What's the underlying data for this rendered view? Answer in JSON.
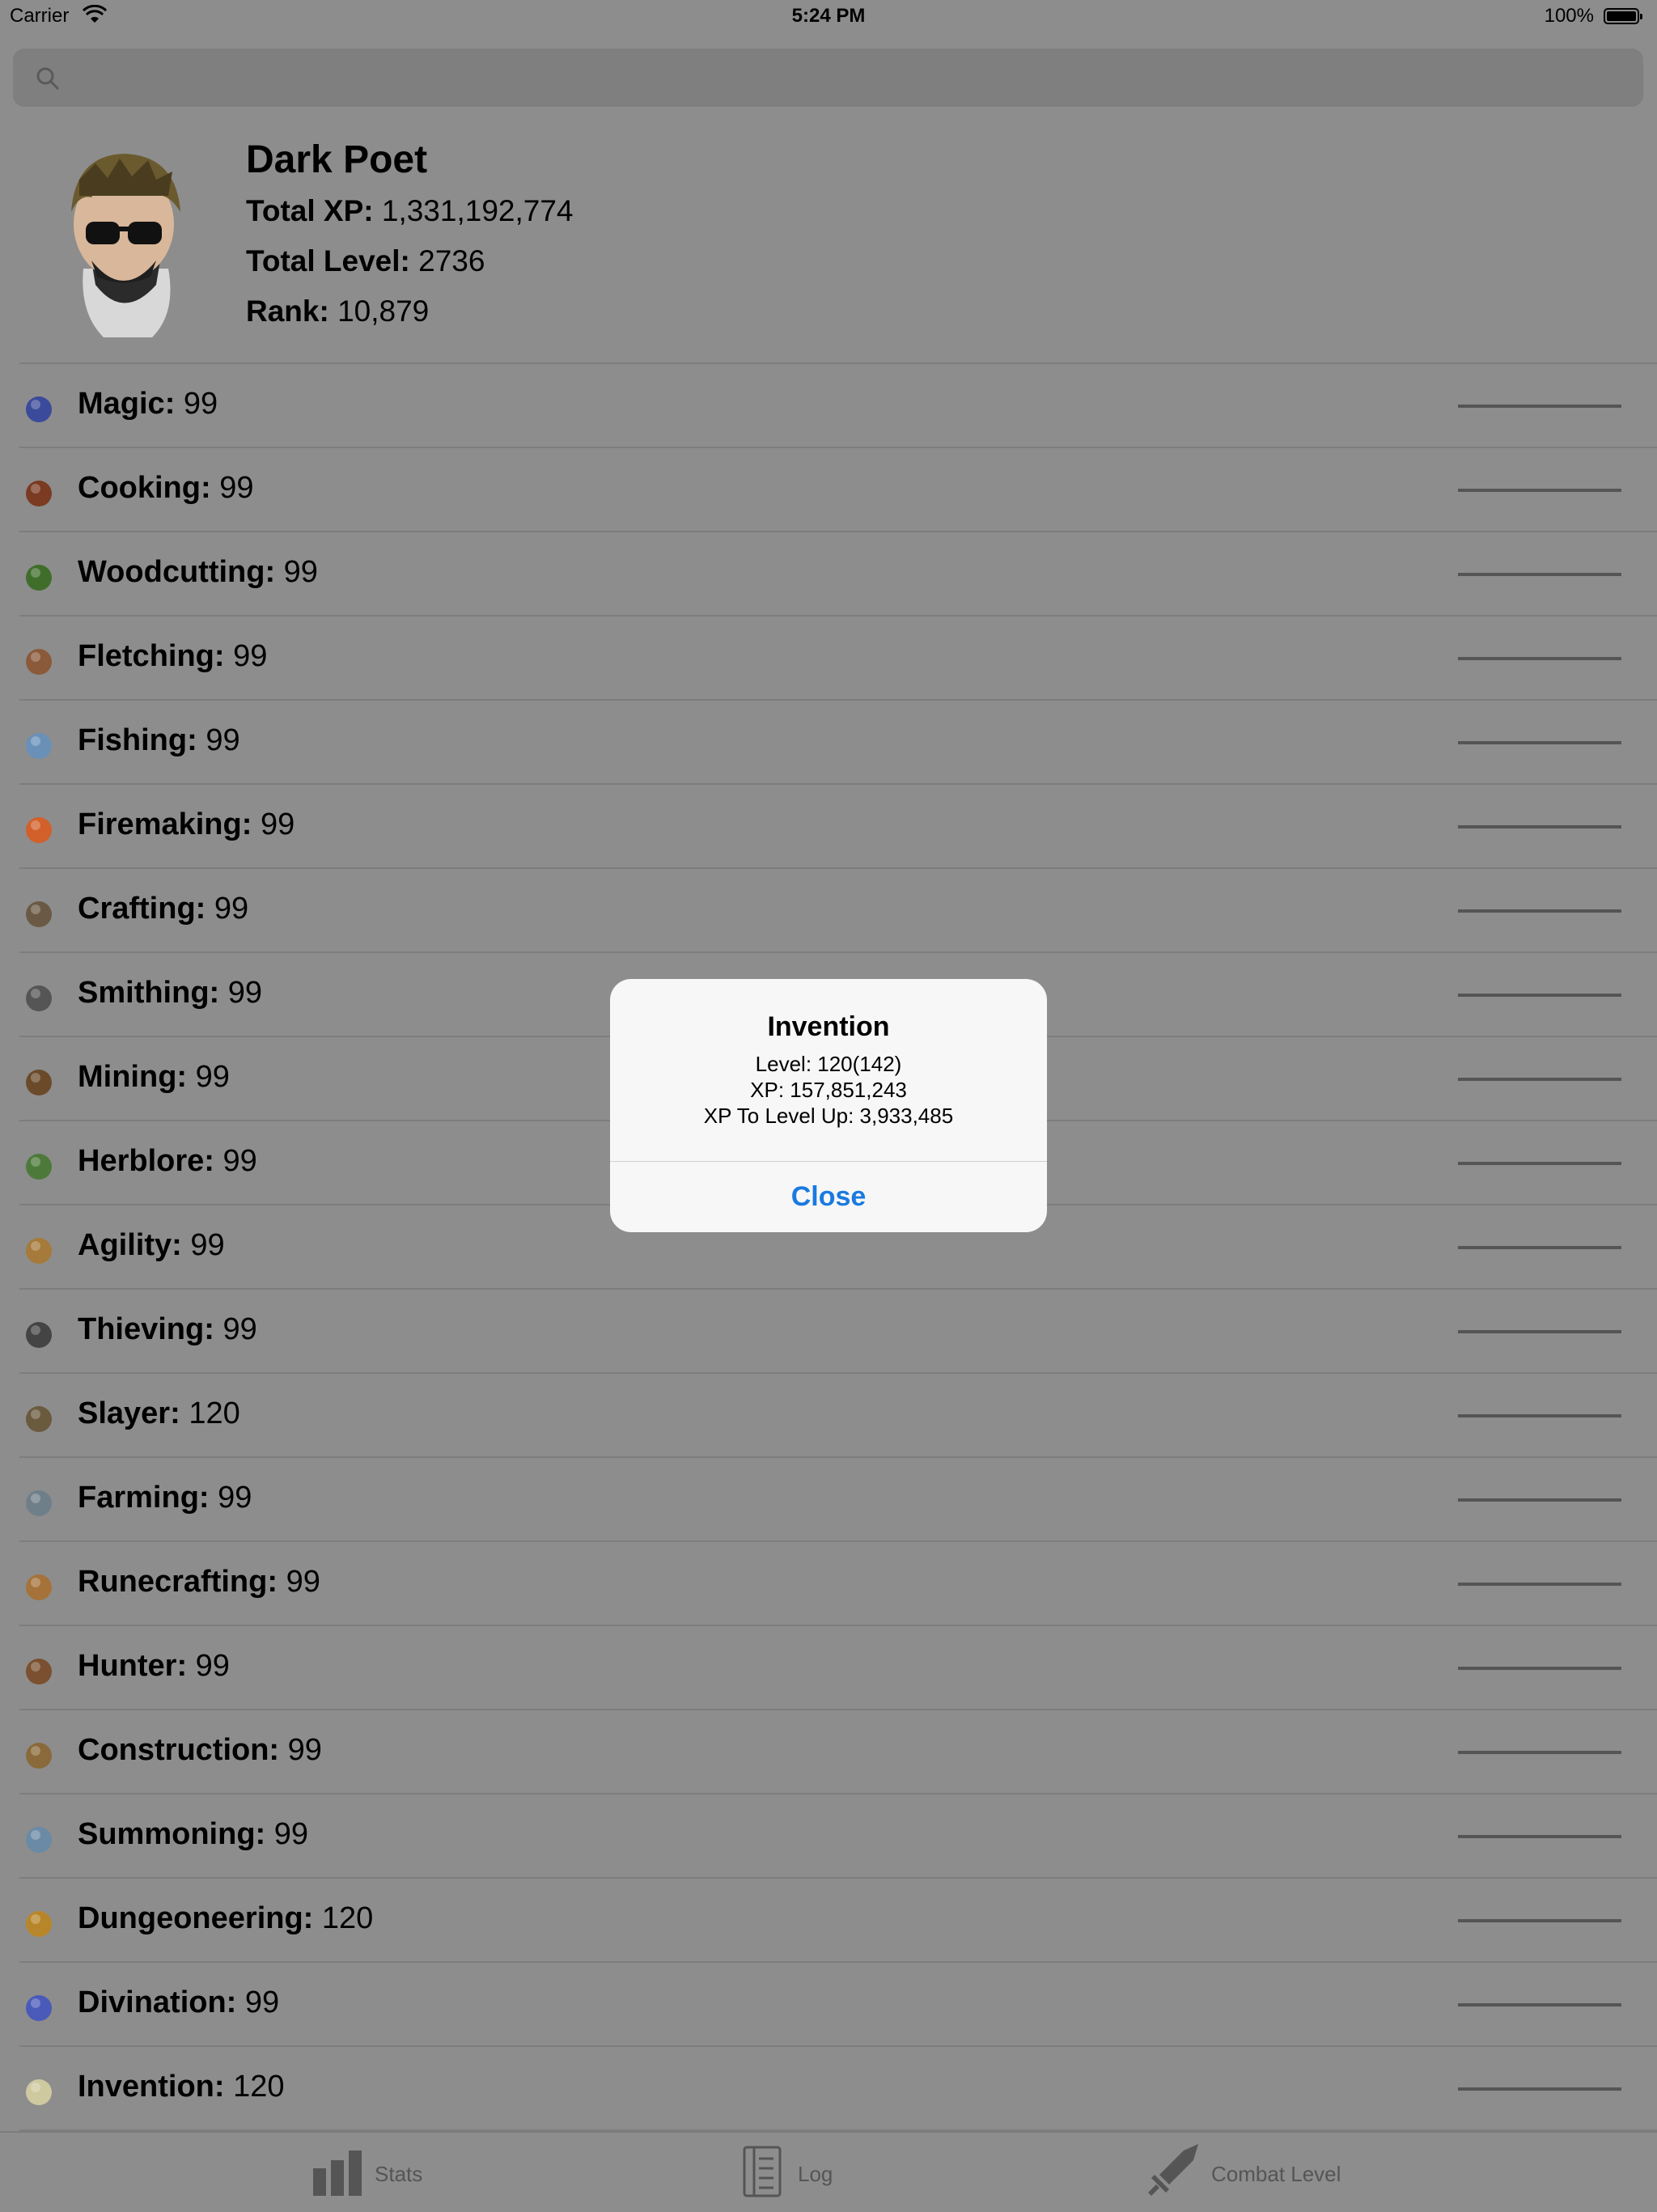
{
  "status_bar": {
    "carrier": "Carrier",
    "time": "5:24 PM",
    "battery": "100%"
  },
  "search": {
    "placeholder": ""
  },
  "profile": {
    "name": "Dark Poet",
    "total_xp_label": "Total XP:",
    "total_xp": "1,331,192,774",
    "total_level_label": "Total Level:",
    "total_level": "2736",
    "rank_label": "Rank:",
    "rank": "10,879"
  },
  "skills": [
    {
      "name": "Magic:",
      "level": "99",
      "icon": "magic-icon"
    },
    {
      "name": "Cooking:",
      "level": "99",
      "icon": "cooking-icon"
    },
    {
      "name": "Woodcutting:",
      "level": "99",
      "icon": "woodcutting-icon"
    },
    {
      "name": "Fletching:",
      "level": "99",
      "icon": "fletching-icon"
    },
    {
      "name": "Fishing:",
      "level": "99",
      "icon": "fishing-icon"
    },
    {
      "name": "Firemaking:",
      "level": "99",
      "icon": "firemaking-icon"
    },
    {
      "name": "Crafting:",
      "level": "99",
      "icon": "crafting-icon"
    },
    {
      "name": "Smithing:",
      "level": "99",
      "icon": "smithing-icon"
    },
    {
      "name": "Mining:",
      "level": "99",
      "icon": "mining-icon"
    },
    {
      "name": "Herblore:",
      "level": "99",
      "icon": "herblore-icon"
    },
    {
      "name": "Agility:",
      "level": "99",
      "icon": "agility-icon"
    },
    {
      "name": "Thieving:",
      "level": "99",
      "icon": "thieving-icon"
    },
    {
      "name": "Slayer:",
      "level": "120",
      "icon": "slayer-icon"
    },
    {
      "name": "Farming:",
      "level": "99",
      "icon": "farming-icon"
    },
    {
      "name": "Runecrafting:",
      "level": "99",
      "icon": "runecrafting-icon"
    },
    {
      "name": "Hunter:",
      "level": "99",
      "icon": "hunter-icon"
    },
    {
      "name": "Construction:",
      "level": "99",
      "icon": "construction-icon"
    },
    {
      "name": "Summoning:",
      "level": "99",
      "icon": "summoning-icon"
    },
    {
      "name": "Dungeoneering:",
      "level": "120",
      "icon": "dungeoneering-icon"
    },
    {
      "name": "Divination:",
      "level": "99",
      "icon": "divination-icon"
    },
    {
      "name": "Invention:",
      "level": "120",
      "icon": "invention-icon"
    }
  ],
  "dialog": {
    "title": "Invention",
    "level": "Level: 120(142)",
    "xp": "XP: 157,851,243",
    "xp_to_level": "XP To Level Up: 3,933,485",
    "close": "Close"
  },
  "tabs": [
    {
      "label": "Stats",
      "icon": "bar-chart-icon"
    },
    {
      "label": "Log",
      "icon": "log-icon"
    },
    {
      "label": "Combat Level",
      "icon": "sword-icon"
    }
  ],
  "colors": {
    "dim_background": "#8d8d8d",
    "dialog_background": "#f7f7f7",
    "link_blue": "#1a7ae0"
  }
}
